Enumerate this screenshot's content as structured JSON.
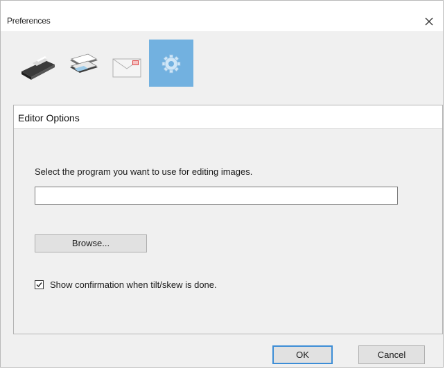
{
  "window": {
    "title": "Preferences"
  },
  "toolbar": {
    "items": [
      {
        "icon": "scanner-icon",
        "selected": false
      },
      {
        "icon": "document-feed-icon",
        "selected": false
      },
      {
        "icon": "email-icon",
        "selected": false
      },
      {
        "icon": "gear-icon",
        "selected": true
      }
    ]
  },
  "panel": {
    "title": "Editor Options",
    "prompt": "Select the program you want to use for editing images.",
    "path_value": "",
    "browse_label": "Browse...",
    "checkbox_label": "Show confirmation when tilt/skew is done.",
    "checkbox_checked": true
  },
  "footer": {
    "ok_label": "OK",
    "cancel_label": "Cancel"
  },
  "colors": {
    "selected_tool": "#72b1e0",
    "default_button_border": "#3c8dd6"
  }
}
